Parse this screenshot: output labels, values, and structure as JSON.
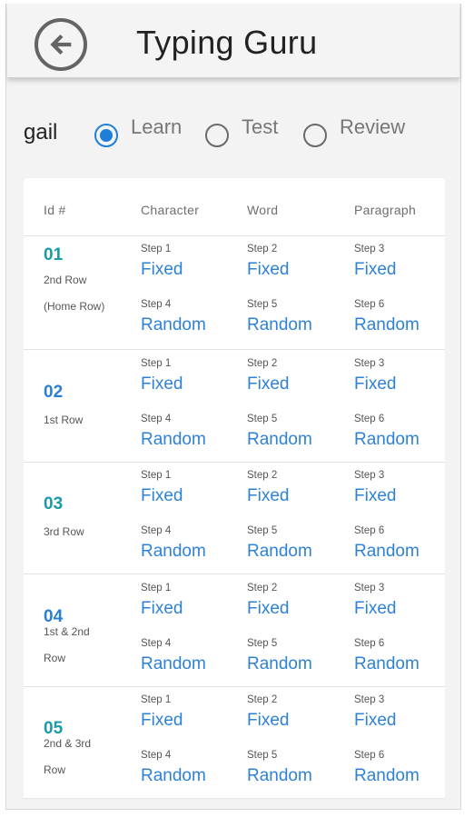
{
  "app": {
    "title": "Typing Guru"
  },
  "user": {
    "name": "gail"
  },
  "modes": [
    {
      "label": "Learn",
      "selected": true
    },
    {
      "label": "Test",
      "selected": false
    },
    {
      "label": "Review",
      "selected": false
    }
  ],
  "columns": [
    "Id #",
    "Character",
    "Word",
    "Paragraph"
  ],
  "lessons": [
    {
      "id": "01",
      "description": "2nd Row (Home Row)",
      "id_color": "#1a9aa8",
      "steps": [
        {
          "label": "Step 1",
          "mode": "Fixed"
        },
        {
          "label": "Step 2",
          "mode": "Fixed"
        },
        {
          "label": "Step 3",
          "mode": "Fixed"
        },
        {
          "label": "Step 4",
          "mode": "Random"
        },
        {
          "label": "Step 5",
          "mode": "Random"
        },
        {
          "label": "Step 6",
          "mode": "Random"
        }
      ]
    },
    {
      "id": "02",
      "description": "1st Row",
      "id_color": "#2a7fd6",
      "steps": [
        {
          "label": "Step 1",
          "mode": "Fixed"
        },
        {
          "label": "Step 2",
          "mode": "Fixed"
        },
        {
          "label": "Step 3",
          "mode": "Fixed"
        },
        {
          "label": "Step 4",
          "mode": "Random"
        },
        {
          "label": "Step 5",
          "mode": "Random"
        },
        {
          "label": "Step 6",
          "mode": "Random"
        }
      ]
    },
    {
      "id": "03",
      "description": "3rd Row",
      "id_color": "#1a9aa8",
      "steps": [
        {
          "label": "Step 1",
          "mode": "Fixed"
        },
        {
          "label": "Step 2",
          "mode": "Fixed"
        },
        {
          "label": "Step 3",
          "mode": "Fixed"
        },
        {
          "label": "Step 4",
          "mode": "Random"
        },
        {
          "label": "Step 5",
          "mode": "Random"
        },
        {
          "label": "Step 6",
          "mode": "Random"
        }
      ]
    },
    {
      "id": "04",
      "description": "1st & 2nd Row",
      "id_color": "#2a7fd6",
      "steps": [
        {
          "label": "Step 1",
          "mode": "Fixed"
        },
        {
          "label": "Step 2",
          "mode": "Fixed"
        },
        {
          "label": "Step 3",
          "mode": "Fixed"
        },
        {
          "label": "Step 4",
          "mode": "Random"
        },
        {
          "label": "Step 5",
          "mode": "Random"
        },
        {
          "label": "Step 6",
          "mode": "Random"
        }
      ]
    },
    {
      "id": "05",
      "description": "2nd & 3rd Row",
      "id_color": "#1a9aa8",
      "steps": [
        {
          "label": "Step 1",
          "mode": "Fixed"
        },
        {
          "label": "Step 2",
          "mode": "Fixed"
        },
        {
          "label": "Step 3",
          "mode": "Fixed"
        },
        {
          "label": "Step 4",
          "mode": "Random"
        },
        {
          "label": "Step 5",
          "mode": "Random"
        },
        {
          "label": "Step 6",
          "mode": "Random"
        }
      ]
    }
  ],
  "icons": {
    "back": "back-arrow-icon"
  },
  "colors": {
    "accent": "#1e7fd8",
    "link": "#2e82d6"
  }
}
